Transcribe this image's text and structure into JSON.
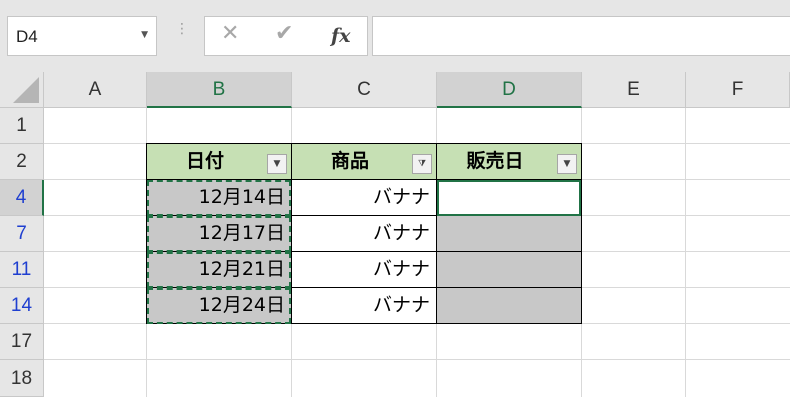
{
  "namebox": {
    "value": "D4",
    "arrow_icon": "chevron-down-icon"
  },
  "formula_bar": {
    "cancel": "✕",
    "enter": "✔",
    "fx": "fx",
    "value": ""
  },
  "columns": [
    "A",
    "B",
    "C",
    "D",
    "E",
    "F"
  ],
  "rows": [
    "1",
    "2",
    "4",
    "7",
    "11",
    "14",
    "17",
    "18"
  ],
  "table": {
    "headers": [
      "日付",
      "商品",
      "販売日"
    ],
    "rows": [
      [
        "12月14日",
        "バナナ",
        ""
      ],
      [
        "12月17日",
        "バナナ",
        ""
      ],
      [
        "12月21日",
        "バナナ",
        ""
      ],
      [
        "12月24日",
        "バナナ",
        ""
      ]
    ]
  },
  "colors": {
    "header_fill": "#c6e0b4",
    "accent": "#217346",
    "filtered_row_number": "#1f3fd0",
    "selected_gray": "#c8c8c8"
  }
}
